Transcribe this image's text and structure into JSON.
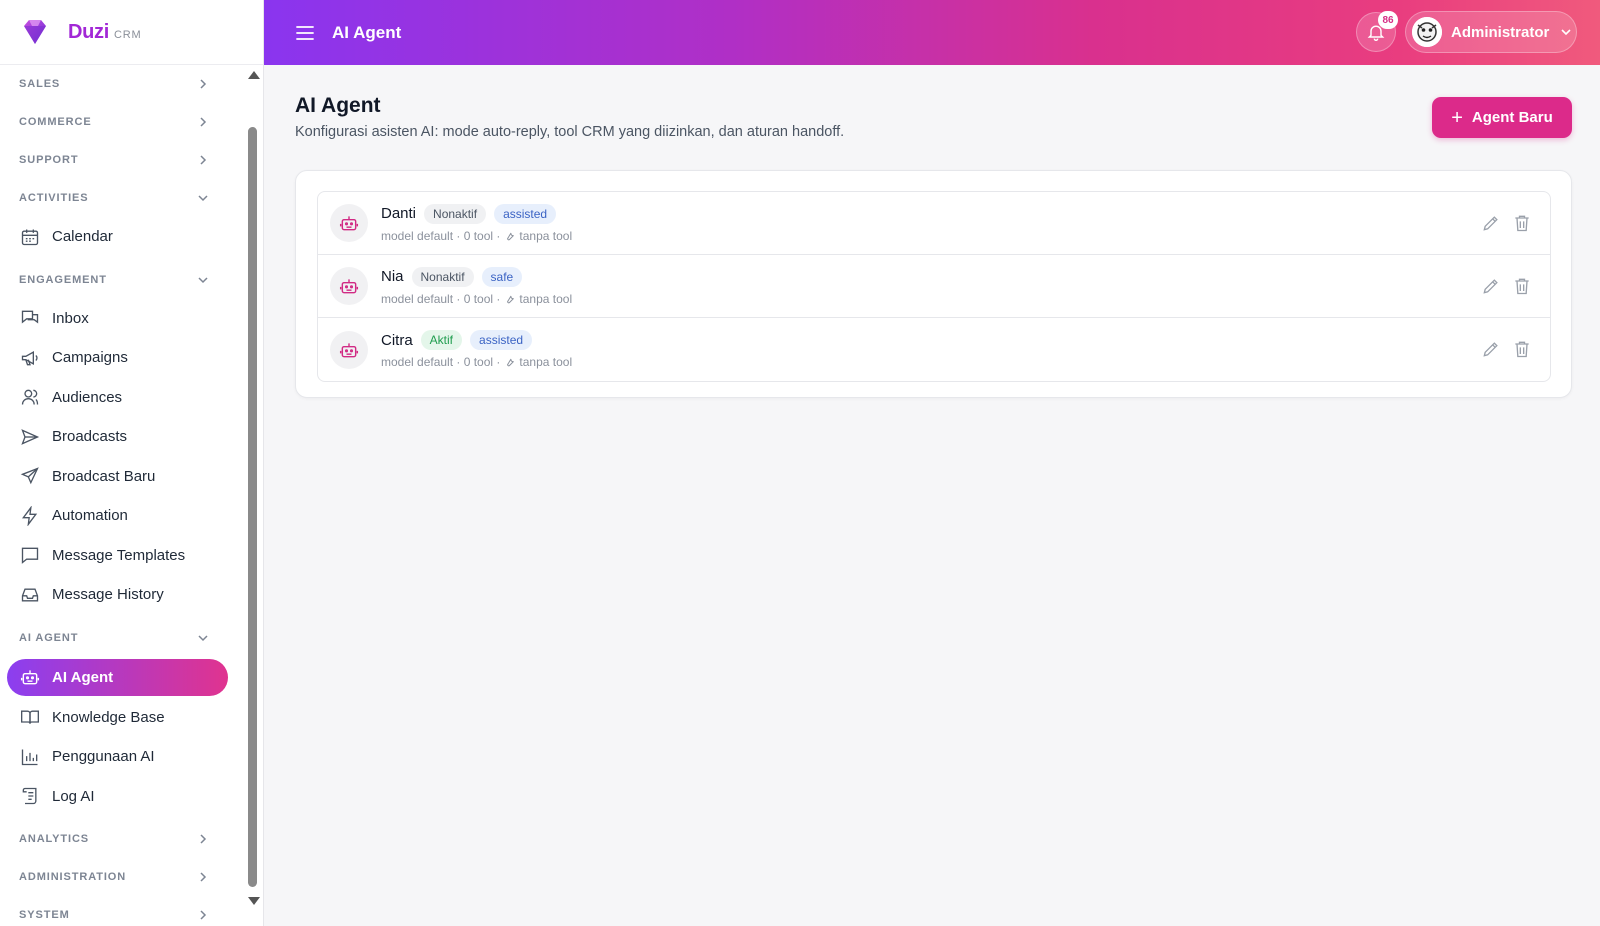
{
  "brand": {
    "name": "Duzi",
    "sub": "CRM"
  },
  "topbar": {
    "title": "AI Agent",
    "notification_count": "86",
    "user_name": "Administrator"
  },
  "sidebar": {
    "sections": {
      "sales": "SALES",
      "commerce": "COMMERCE",
      "support": "SUPPORT",
      "activities": "ACTIVITIES",
      "engagement": "ENGAGEMENT",
      "ai_agent": "AI AGENT",
      "analytics": "ANALYTICS",
      "administration": "ADMINISTRATION",
      "system": "SYSTEM"
    },
    "items": {
      "calendar": "Calendar",
      "inbox": "Inbox",
      "campaigns": "Campaigns",
      "audiences": "Audiences",
      "broadcasts": "Broadcasts",
      "broadcast_baru": "Broadcast Baru",
      "automation": "Automation",
      "message_templates": "Message Templates",
      "message_history": "Message History",
      "ai_agent": "AI Agent",
      "knowledge_base": "Knowledge Base",
      "penggunaan_ai": "Penggunaan AI",
      "log_ai": "Log AI"
    }
  },
  "main": {
    "title": "AI Agent",
    "subtitle": "Konfigurasi asisten AI: mode auto-reply, tool CRM yang diizinkan, dan aturan handoff.",
    "new_button": "Agent Baru",
    "agents": [
      {
        "name": "Danti",
        "status": "Nonaktif",
        "mode": "assisted",
        "meta": "model default · 0 tool ·",
        "tools": "tanpa tool"
      },
      {
        "name": "Nia",
        "status": "Nonaktif",
        "mode": "safe",
        "meta": "model default · 0 tool ·",
        "tools": "tanpa tool"
      },
      {
        "name": "Citra",
        "status": "Aktif",
        "mode": "assisted",
        "meta": "model default · 0 tool ·",
        "tools": "tanpa tool"
      }
    ]
  },
  "colors": {
    "brand": "#a228d6",
    "accent": "#dc2a8a",
    "active_status": "#1f9d4e"
  },
  "icons": {
    "logo": "gem-logo-icon",
    "menu": "hamburger-icon",
    "bell": "bell-icon",
    "bot": "robot-icon",
    "edit": "pencil-icon",
    "delete": "trash-icon",
    "wrench": "wrench-icon"
  }
}
